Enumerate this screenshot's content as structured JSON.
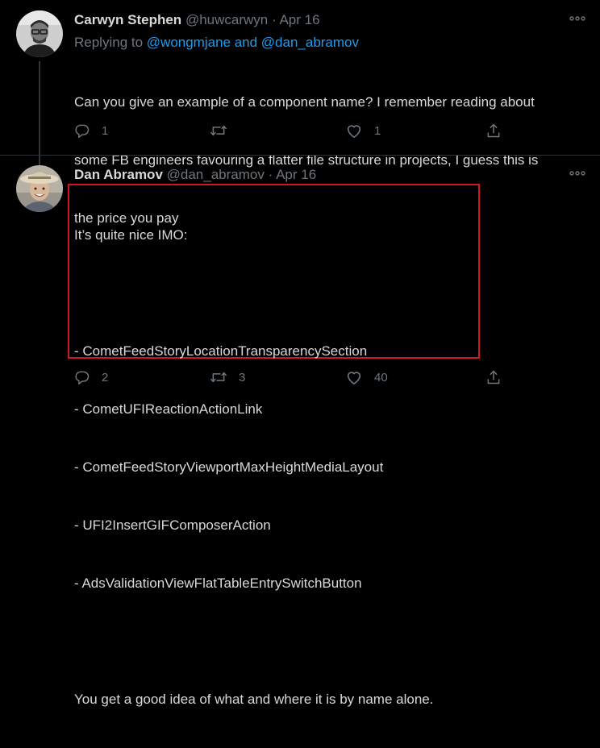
{
  "tweets": [
    {
      "name": "Carwyn Stephen",
      "handle": "@huwcarwyn",
      "dot": "·",
      "date": "Apr 16",
      "replying_prefix": "Replying to ",
      "replying_mentions": "@wongmjane and @dan_abramov",
      "body": [
        "Can you give an example of a component name? I remember reading about",
        "some FB engineers favouring a flatter file structure in projects, I guess this is",
        "the price you pay"
      ],
      "actions": {
        "reply_count": "1",
        "retweet_count": "",
        "like_count": "1"
      },
      "icons": {
        "more": "more-icon",
        "reply": "reply-icon",
        "retweet": "retweet-icon",
        "like": "like-icon",
        "share": "share-icon"
      }
    },
    {
      "name": "Dan Abramov",
      "handle": "@dan_abramov",
      "dot": "·",
      "date": "Apr 16",
      "body": [
        "It’s quite nice IMO:",
        "",
        "- CometFeedStoryLocationTransparencySection",
        "- CometUFIReactionActionLink",
        "- CometFeedStoryViewportMaxHeightMediaLayout",
        "- UFI2InsertGIFComposerAction",
        "- AdsValidationViewFlatTableEntrySwitchButton",
        "",
        "You get a good idea of what and where it is by name alone."
      ],
      "actions": {
        "reply_count": "2",
        "retweet_count": "3",
        "like_count": "40"
      },
      "icons": {
        "more": "more-icon",
        "reply": "reply-icon",
        "retweet": "retweet-icon",
        "like": "like-icon",
        "share": "share-icon"
      }
    }
  ],
  "colors": {
    "background": "#000000",
    "text": "#d9d9d9",
    "muted": "#6e767d",
    "link": "#1d9bf0",
    "highlight": "#d0161f"
  }
}
